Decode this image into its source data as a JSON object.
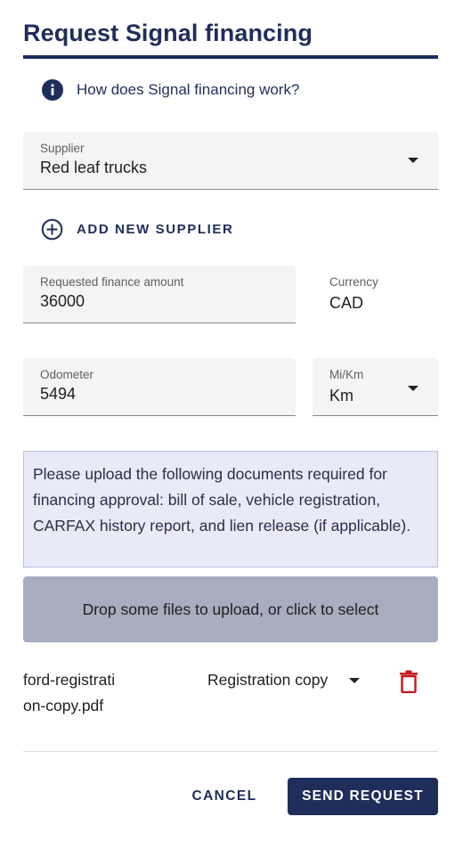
{
  "title": "Request Signal financing",
  "info_link": {
    "label": "How does Signal financing work?"
  },
  "supplier": {
    "label": "Supplier",
    "value": "Red leaf trucks"
  },
  "add_supplier": {
    "label": "ADD NEW SUPPLIER"
  },
  "amount": {
    "label": "Requested finance amount",
    "value": "36000"
  },
  "currency": {
    "label": "Currency",
    "value": "CAD"
  },
  "odometer": {
    "label": "Odometer",
    "value": "5494"
  },
  "unit": {
    "label": "Mi/Km",
    "value": "Km"
  },
  "notice": "Please upload the following documents required for financing approval: bill of sale, vehicle registration, CARFAX history report, and lien release (if applicable).",
  "dropzone": "Drop some files to upload, or click to select",
  "file": {
    "name": "ford-registration-copy.pdf",
    "type": "Registration copy"
  },
  "actions": {
    "cancel": "CANCEL",
    "send": "SEND REQUEST"
  },
  "colors": {
    "brand": "#1f2d5a",
    "delete": "#c4161c",
    "notice_bg": "#e8eaf8",
    "dropzone_bg": "#a8adbf"
  },
  "icons": {
    "info": "info-icon",
    "add": "plus-circle-icon",
    "delete": "trash-icon",
    "dropdown": "caret-down-icon"
  }
}
